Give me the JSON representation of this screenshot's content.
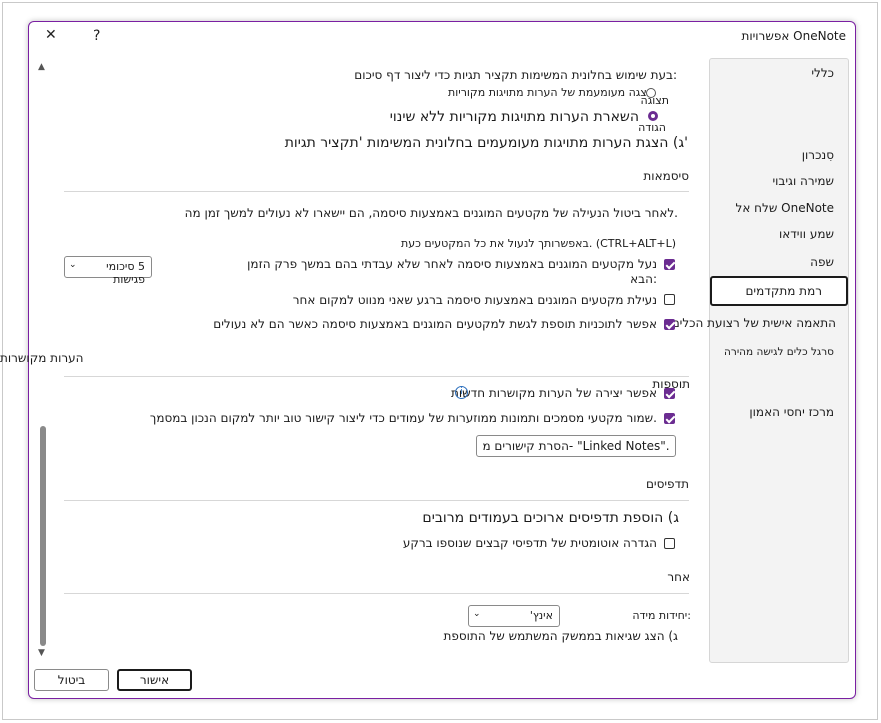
{
  "window": {
    "title": "אפשרויות OneNote",
    "help_glyph": "?",
    "close_glyph": "✕"
  },
  "sidebar": {
    "items": [
      {
        "label": "כללי"
      },
      {
        "label": "סִנכרון"
      },
      {
        "label": "שמירה וגיבוי"
      },
      {
        "label": "שלח אל OneNote"
      },
      {
        "label": "שמע ווידאו"
      },
      {
        "label": "שפה"
      },
      {
        "label": "רמת מתקדמים"
      },
      {
        "label": "התאמה אישית של רצועת הכלים"
      },
      {
        "label": "סרגל כלים לגישה מהירה"
      },
      {
        "label": "מרכז יחסי האמון"
      }
    ]
  },
  "summary": {
    "heading": "בעת שימוש בחלונית המשימות תקציר תגיות כדי ליצור דף סיכום:",
    "radio_show_label": "הצגה מעומעמת של הערות מתויגות מקוריות",
    "radio_show_tag": "תצוגה",
    "radio_keep_label": "השארת הערות מתויגות מקוריות ללא שינוי",
    "radio_keep_tag": "הגודה",
    "dimmed_label": "ג) הצגת הערות מתויגות מעומעמים בחלונית המשימות 'תקציר תגיות'"
  },
  "passwords": {
    "heading": "סיסמאות",
    "desc": "לאחר ביטול הנעילה של מקטעים המוגנים באמצעות סיסמה, הם יישארו לא נעולים למשך זמן מה.",
    "shortcut_note": "באפשרותך לנעול את כל המקטעים כעת. (CTRL+ALT+L)",
    "lock_after_label": "נעל מקטעים המוגנים באמצעות סיסמה לאחר שלא עבדתי בהם במשך פרק הזמן",
    "lock_after_label2": "הבא:",
    "lock_after_value": "5 סיכומי פגישות",
    "lock_on_leave_label": "נעילת מקטעים המוגנים באמצעות סיסמה ברגע שאני מנווט למקום אחר",
    "allow_addins_label": "אפשר לתוכניות תוספת לגשת למקטעים המוגנים באמצעות סיסמה כאשר הם לא נעולים"
  },
  "linked_notes": {
    "heading": "הערות מקושרות",
    "addins_heading": "תוספות",
    "allow_new_label": "אפשר יצירה של הערות מקושרות חדשות",
    "info_glyph": "i",
    "keep_docs_label": "שמור מקטעי מסמכים ותמונות ממוזערות של עמודים כדי ליצור קישור טוב יותר למקום הנכון במסמך.",
    "remove_links_button": "הסרת קישורים מ-  \"Linked Notes\"."
  },
  "printouts": {
    "heading": "תדפיסים",
    "insert_long_label": "ג) הוספת תדפיסים ארוכים בעמודים מרובים",
    "auto_bg_label": "הגדרה אוטומטית של תדפיסי קבצים שנוספו ברקע"
  },
  "other": {
    "heading": "אחר",
    "units_label": "יחידות מידה:",
    "units_value": "אינץ'",
    "show_errors_label": "ג) הצג שגיאות בממשק המשתמש של התוספת"
  },
  "footer": {
    "ok_label": "אישור",
    "cancel_label": "ביטול"
  },
  "colors": {
    "accent": "#6b2c91",
    "dialog_border": "#7a1fa2"
  }
}
